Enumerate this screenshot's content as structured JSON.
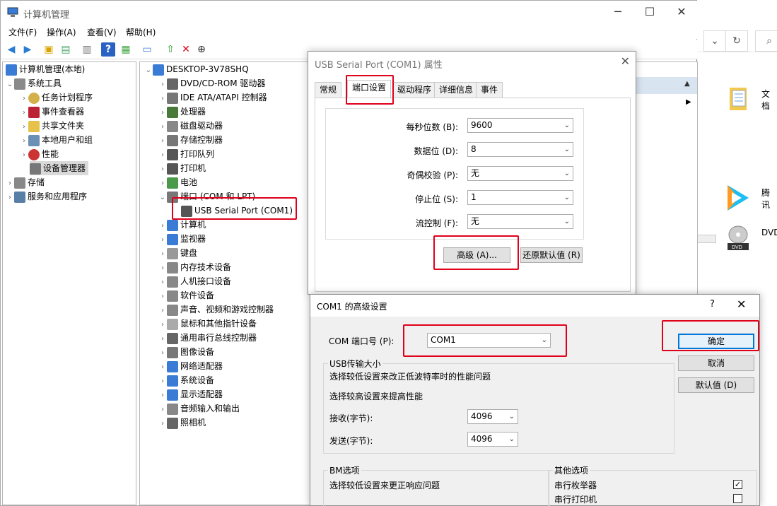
{
  "explorer_bg": {
    "refresh_icon": "refresh-icon",
    "search_icon": "search-icon",
    "items": [
      {
        "label": "文档"
      },
      {
        "label": "腾讯"
      },
      {
        "label": "DVD"
      }
    ]
  },
  "window": {
    "title": "计算机管理",
    "minimize": "─",
    "maximize": "☐",
    "close": "✕"
  },
  "menu": {
    "file": "文件(F)",
    "action": "操作(A)",
    "view": "查看(V)",
    "help": "帮助(H)"
  },
  "left_tree": {
    "root": "计算机管理(本地)",
    "system_tools": "系统工具",
    "task_scheduler": "任务计划程序",
    "event_viewer": "事件查看器",
    "shared_folders": "共享文件夹",
    "local_users": "本地用户和组",
    "performance": "性能",
    "device_manager": "设备管理器",
    "storage": "存储",
    "services": "服务和应用程序"
  },
  "device_tree": {
    "host": "DESKTOP-3V78SHQ",
    "items": [
      "DVD/CD-ROM 驱动器",
      "IDE ATA/ATAPI 控制器",
      "处理器",
      "磁盘驱动器",
      "存储控制器",
      "打印队列",
      "打印机",
      "电池",
      "端口 (COM 和 LPT)",
      "USB Serial Port (COM1)",
      "计算机",
      "监视器",
      "键盘",
      "内存技术设备",
      "人机接口设备",
      "软件设备",
      "声音、视频和游戏控制器",
      "鼠标和其他指针设备",
      "通用串行总线控制器",
      "图像设备",
      "网络适配器",
      "系统设备",
      "显示适配器",
      "音频输入和输出",
      "照相机"
    ]
  },
  "props_dialog": {
    "title": "USB Serial Port (COM1) 属性",
    "close": "✕",
    "tabs": [
      "常规",
      "端口设置",
      "驱动程序",
      "详细信息",
      "事件"
    ],
    "fields": [
      {
        "label": "每秒位数 (B):",
        "value": "9600"
      },
      {
        "label": "数据位 (D):",
        "value": "8"
      },
      {
        "label": "奇偶校验 (P):",
        "value": "无"
      },
      {
        "label": "停止位 (S):",
        "value": "1"
      },
      {
        "label": "流控制 (F):",
        "value": "无"
      }
    ],
    "advanced_button": "高级 (A)...",
    "restore_button": "还原默认值 (R)"
  },
  "adv_dialog": {
    "title": "COM1 的高级设置",
    "help": "?",
    "close": "✕",
    "com_port_label": "COM 端口号 (P):",
    "com_port_value": "COM1",
    "usb_group_title": "USB传输大小",
    "usb_desc_low": "选择较低设置来改正低波特率时的性能问题",
    "usb_desc_high": "选择较高设置来提高性能",
    "receive_label": "接收(字节):",
    "receive_value": "4096",
    "send_label": "发送(字节):",
    "send_value": "4096",
    "ok_button": "确定",
    "cancel_button": "取消",
    "defaults_button": "默认值 (D)",
    "bm_group_title": "BM选项",
    "bm_desc": "选择较低设置来更正响应问题",
    "other_group_title": "其他选项",
    "serial_enum_label": "串行枚举器",
    "serial_enum_checked": true,
    "serial_printer_label": "串行打印机",
    "serial_printer_checked": false
  },
  "colors": {
    "highlight_red": "#e0001a",
    "accent_blue": "#0078d7"
  }
}
